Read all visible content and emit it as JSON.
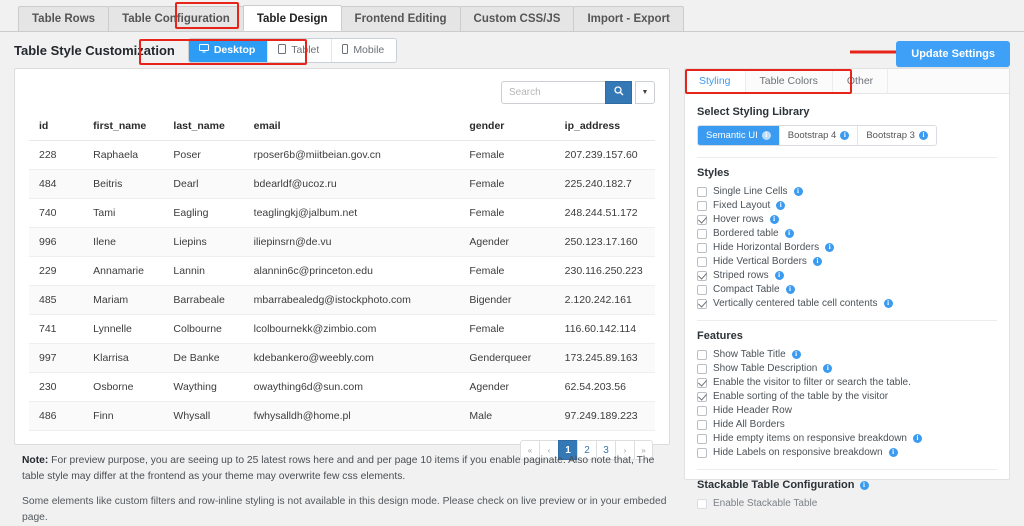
{
  "tabs": [
    {
      "label": "Table Rows",
      "active": false
    },
    {
      "label": "Table Configuration",
      "active": false
    },
    {
      "label": "Table Design",
      "active": true
    },
    {
      "label": "Frontend Editing",
      "active": false
    },
    {
      "label": "Custom CSS/JS",
      "active": false
    },
    {
      "label": "Import - Export",
      "active": false
    }
  ],
  "header": {
    "title": "Table Style Customization",
    "devices": [
      {
        "label": "Desktop",
        "icon": "monitor-icon",
        "active": true
      },
      {
        "label": "Tablet",
        "icon": "tablet-icon",
        "active": false
      },
      {
        "label": "Mobile",
        "icon": "mobile-icon",
        "active": false
      }
    ],
    "update_label": "Update Settings"
  },
  "preview": {
    "search": {
      "value": "",
      "placeholder": "Search",
      "search_icon": "magnifier-icon",
      "caret_icon": "chevron-down-icon"
    },
    "columns": [
      "id",
      "first_name",
      "last_name",
      "email",
      "gender",
      "ip_address"
    ],
    "rows": [
      [
        "228",
        "Raphaela",
        "Poser",
        "rposer6b@miitbeian.gov.cn",
        "Female",
        "207.239.157.60"
      ],
      [
        "484",
        "Beitris",
        "Dearl",
        "bdearldf@ucoz.ru",
        "Female",
        "225.240.182.7"
      ],
      [
        "740",
        "Tami",
        "Eagling",
        "teaglingkj@jalbum.net",
        "Female",
        "248.244.51.172"
      ],
      [
        "996",
        "Ilene",
        "Liepins",
        "iliepinsrn@de.vu",
        "Agender",
        "250.123.17.160"
      ],
      [
        "229",
        "Annamarie",
        "Lannin",
        "alannin6c@princeton.edu",
        "Female",
        "230.116.250.223"
      ],
      [
        "485",
        "Mariam",
        "Barrabeale",
        "mbarrabealedg@istockphoto.com",
        "Bigender",
        "2.120.242.161"
      ],
      [
        "741",
        "Lynnelle",
        "Colbourne",
        "lcolbournekk@zimbio.com",
        "Female",
        "116.60.142.114"
      ],
      [
        "997",
        "Klarrisa",
        "De Banke",
        "kdebankero@weebly.com",
        "Genderqueer",
        "173.245.89.163"
      ],
      [
        "230",
        "Osborne",
        "Waything",
        "owaything6d@sun.com",
        "Agender",
        "62.54.203.56"
      ],
      [
        "486",
        "Finn",
        "Whysall",
        "fwhysalldh@home.pl",
        "Male",
        "97.249.189.223"
      ]
    ],
    "pagination": [
      {
        "label": "«",
        "type": "muted"
      },
      {
        "label": "‹",
        "type": "muted"
      },
      {
        "label": "1",
        "type": "current"
      },
      {
        "label": "2",
        "type": "normal"
      },
      {
        "label": "3",
        "type": "normal"
      },
      {
        "label": "›",
        "type": "muted"
      },
      {
        "label": "»",
        "type": "muted"
      }
    ]
  },
  "notes": {
    "label": "Note:",
    "line1": " For preview purpose, you are seeing up to 25 latest rows here and and per page 10 items if you enable paginate. Also note that, The table style may differ at the frontend as your theme may overwrite few css elements.",
    "line2": "Some elements like custom filters and row-inline styling is not available in this design mode. Please check on live preview or in your embeded page."
  },
  "panel": {
    "tabs": [
      {
        "label": "Styling",
        "active": true
      },
      {
        "label": "Table Colors",
        "active": false
      },
      {
        "label": "Other",
        "active": false
      }
    ],
    "library_heading": "Select Styling Library",
    "libraries": [
      {
        "label": "Semantic UI",
        "active": true,
        "info": "info-icon"
      },
      {
        "label": "Bootstrap 4",
        "active": false,
        "info": "info-icon"
      },
      {
        "label": "Bootstrap 3",
        "active": false,
        "info": "info-icon"
      }
    ],
    "styles_heading": "Styles",
    "styles": [
      {
        "label": "Single Line Cells",
        "checked": false,
        "info": true
      },
      {
        "label": "Fixed Layout",
        "checked": false,
        "info": true
      },
      {
        "label": "Hover rows",
        "checked": true,
        "info": true
      },
      {
        "label": "Bordered table",
        "checked": false,
        "info": true
      },
      {
        "label": "Hide Horizontal Borders",
        "checked": false,
        "info": true
      },
      {
        "label": "Hide Vertical Borders",
        "checked": false,
        "info": true
      },
      {
        "label": "Striped rows",
        "checked": true,
        "info": true
      },
      {
        "label": "Compact Table",
        "checked": false,
        "info": true
      },
      {
        "label": "Vertically centered table cell contents",
        "checked": true,
        "info": true
      }
    ],
    "features_heading": "Features",
    "features": [
      {
        "label": "Show Table Title",
        "checked": false,
        "info": true
      },
      {
        "label": "Show Table Description",
        "checked": false,
        "info": true
      },
      {
        "label": "Enable the visitor to filter or search the table.",
        "checked": true,
        "info": false
      },
      {
        "label": "Enable sorting of the table by the visitor",
        "checked": true,
        "info": false
      },
      {
        "label": "Hide Header Row",
        "checked": false,
        "info": false
      },
      {
        "label": "Hide All Borders",
        "checked": false,
        "info": false
      },
      {
        "label": "Hide empty items on responsive breakdown",
        "checked": false,
        "info": true
      },
      {
        "label": "Hide Labels on responsive breakdown",
        "checked": false,
        "info": true
      }
    ],
    "stackable_heading": "Stackable Table Configuration",
    "stackable": [
      {
        "label": "Enable Stackable Table",
        "checked": false,
        "info": false
      }
    ]
  },
  "colors": {
    "accent_blue": "#3b9bf0",
    "button_blue": "#3478b5",
    "highlight_red": "#e8241a"
  }
}
